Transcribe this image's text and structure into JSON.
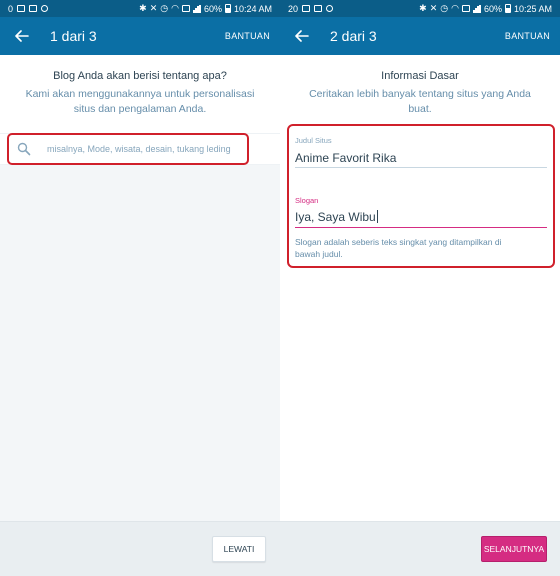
{
  "screens": [
    {
      "status": {
        "left_icons": "0",
        "battery": "60%",
        "time": "10:24 AM"
      },
      "appbar": {
        "title": "1 dari 3",
        "help_label": "BANTUAN"
      },
      "heading": "Blog Anda akan berisi tentang apa?",
      "subtitle": "Kami akan menggunakannya untuk personalisasi situs dan pengalaman Anda.",
      "search": {
        "placeholder": "misalnya, Mode, wisata, desain, tukang leding"
      },
      "footer": {
        "skip_label": "LEWATI"
      }
    },
    {
      "status": {
        "left_icons": "20",
        "battery": "60%",
        "time": "10:25 AM"
      },
      "appbar": {
        "title": "2 dari 3",
        "help_label": "BANTUAN"
      },
      "heading": "Informasi Dasar",
      "subtitle": "Ceritakan lebih banyak tentang situs yang Anda buat.",
      "site_title": {
        "label": "Judul Situs",
        "value": "Anime Favorit Rika"
      },
      "tagline": {
        "label": "Slogan",
        "value": "Iya, Saya Wibu",
        "hint": "Slogan adalah seberis teks singkat yang ditampilkan di bawah judul."
      },
      "footer": {
        "next_label": "SELANJUTNYA"
      }
    }
  ],
  "colors": {
    "status_bar": "#0b5d88",
    "app_bar": "#0b6fa5",
    "highlight": "#d0202b",
    "accent_pink": "#d52c82",
    "text_dark": "#2e4453",
    "text_muted": "#668eaa"
  },
  "icons": {
    "back": "arrow-left-icon",
    "search": "search-icon"
  }
}
